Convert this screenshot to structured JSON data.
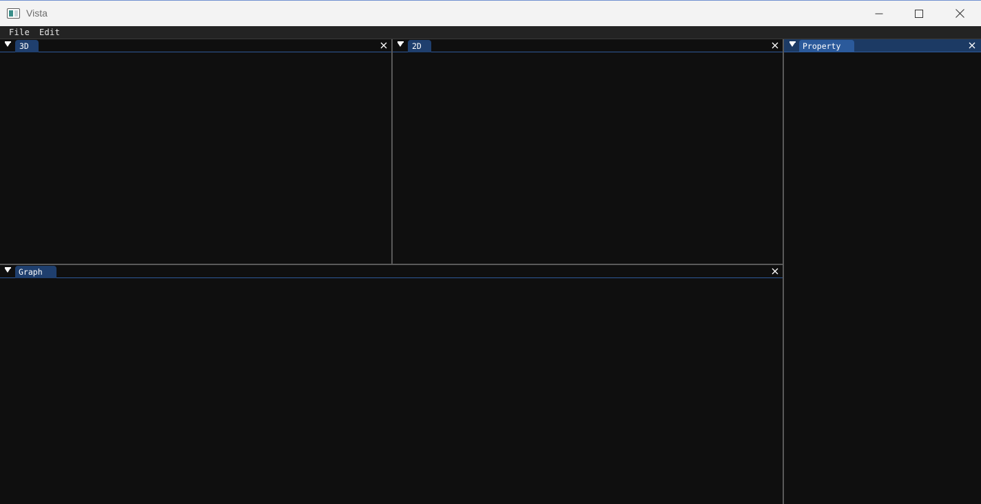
{
  "window": {
    "title": "Vista",
    "minimize_icon": "minimize-icon",
    "maximize_icon": "maximize-icon",
    "close_icon": "close-icon"
  },
  "menubar": {
    "items": [
      {
        "label": "File"
      },
      {
        "label": "Edit"
      }
    ]
  },
  "panels": {
    "view3d": {
      "tab_label": "3D"
    },
    "view2d": {
      "tab_label": "2D"
    },
    "property": {
      "tab_label": "Property"
    },
    "graph": {
      "tab_label": "Graph"
    }
  },
  "colors": {
    "panel_bg": "#0f0f0f",
    "tab_bg": "#1f3f6e",
    "tab_active_bg": "#2b5a9b",
    "accent_line": "#2e5a9a"
  }
}
